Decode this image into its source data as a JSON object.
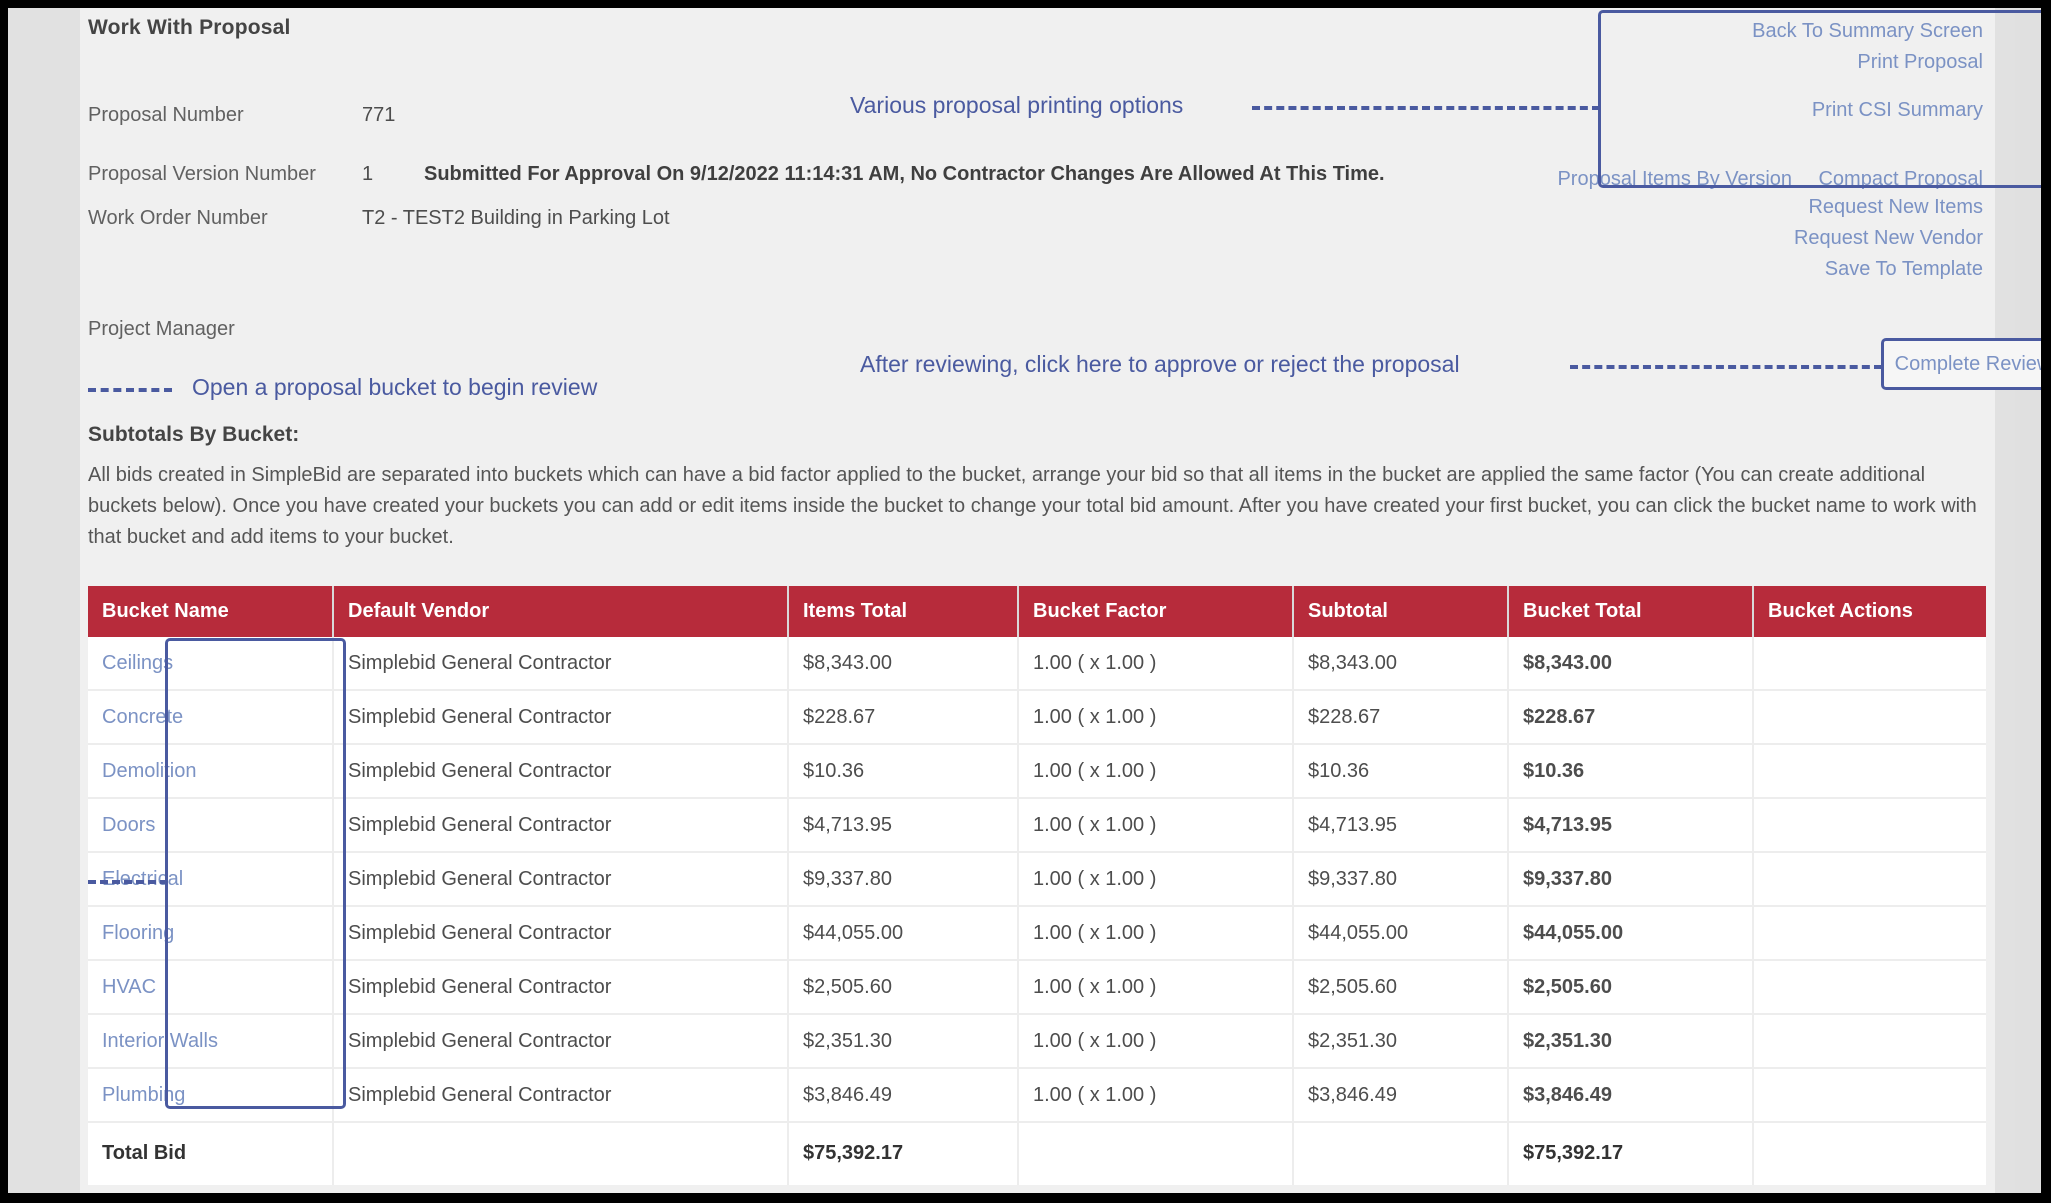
{
  "header": {
    "title": "Work With Proposal",
    "fields": [
      {
        "label": "Proposal Number",
        "value": "771"
      },
      {
        "label": "Proposal Version Number",
        "value": "1"
      },
      {
        "label": "Work Order Number",
        "value": "T2 - TEST2 Building in Parking Lot"
      },
      {
        "label": "Project Manager",
        "value": ""
      }
    ],
    "submitted_note": "Submitted For Approval On 9/12/2022 11:14:31 AM, No Contractor Changes Are Allowed At This Time."
  },
  "nav_links": {
    "back_to_summary": "Back To Summary Screen",
    "print_proposal": "Print Proposal",
    "print_csi_summary": "Print CSI Summary",
    "proposal_items_by_version": "Proposal Items By Version",
    "compact_proposal": "Compact Proposal",
    "request_new_items": "Request New Items",
    "request_new_vendor": "Request New Vendor",
    "save_to_template": "Save To Template",
    "complete_review": "Complete Review"
  },
  "annotations": {
    "printing_options": "Various proposal printing options",
    "complete_review": "After reviewing, click here to approve or reject the proposal",
    "open_bucket": "Open a proposal bucket to begin review"
  },
  "subtotals": {
    "heading": "Subtotals By Bucket:",
    "intro": "All bids created in SimpleBid are separated into buckets which can have a bid factor applied to the bucket, arrange your bid so that all items in the bucket are applied the same factor (You can create additional buckets below).  Once you have created your buckets you can add or edit items inside the bucket to change your total bid amount.  After you have created your first bucket, you can click the bucket name to work with that bucket and add items to your bucket."
  },
  "table": {
    "columns": [
      "Bucket Name",
      "Default Vendor",
      "Items  Total",
      "Bucket Factor",
      "Subtotal",
      "Bucket Total",
      "Bucket Actions"
    ],
    "rows": [
      {
        "name": "Ceilings",
        "vendor": "Simplebid General Contractor",
        "items_total": "$8,343.00",
        "factor": "1.00 ( x 1.00 )",
        "subtotal": "$8,343.00",
        "bucket_total": "$8,343.00",
        "actions": ""
      },
      {
        "name": "Concrete",
        "vendor": "Simplebid General Contractor",
        "items_total": "$228.67",
        "factor": "1.00 ( x 1.00 )",
        "subtotal": "$228.67",
        "bucket_total": "$228.67",
        "actions": ""
      },
      {
        "name": "Demolition",
        "vendor": "Simplebid General Contractor",
        "items_total": "$10.36",
        "factor": "1.00 ( x 1.00 )",
        "subtotal": "$10.36",
        "bucket_total": "$10.36",
        "actions": ""
      },
      {
        "name": "Doors",
        "vendor": "Simplebid General Contractor",
        "items_total": "$4,713.95",
        "factor": "1.00 ( x 1.00 )",
        "subtotal": "$4,713.95",
        "bucket_total": "$4,713.95",
        "actions": ""
      },
      {
        "name": "Electrical",
        "vendor": "Simplebid General Contractor",
        "items_total": "$9,337.80",
        "factor": "1.00 ( x 1.00 )",
        "subtotal": "$9,337.80",
        "bucket_total": "$9,337.80",
        "actions": ""
      },
      {
        "name": "Flooring",
        "vendor": "Simplebid General Contractor",
        "items_total": "$44,055.00",
        "factor": "1.00 ( x 1.00 )",
        "subtotal": "$44,055.00",
        "bucket_total": "$44,055.00",
        "actions": ""
      },
      {
        "name": "HVAC",
        "vendor": "Simplebid General Contractor",
        "items_total": "$2,505.60",
        "factor": "1.00 ( x 1.00 )",
        "subtotal": "$2,505.60",
        "bucket_total": "$2,505.60",
        "actions": ""
      },
      {
        "name": "Interior Walls",
        "vendor": "Simplebid General Contractor",
        "items_total": "$2,351.30",
        "factor": "1.00 ( x 1.00 )",
        "subtotal": "$2,351.30",
        "bucket_total": "$2,351.30",
        "actions": ""
      },
      {
        "name": "Plumbing",
        "vendor": "Simplebid General Contractor",
        "items_total": "$3,846.49",
        "factor": "1.00 ( x 1.00 )",
        "subtotal": "$3,846.49",
        "bucket_total": "$3,846.49",
        "actions": ""
      }
    ],
    "total_row": {
      "label": "Total Bid",
      "vendor": "",
      "items_total": "$75,392.17",
      "factor": "",
      "subtotal": "",
      "bucket_total": "$75,392.17",
      "actions": ""
    }
  },
  "colors": {
    "table_header_red": "#b72b3b",
    "link_blue": "#7b92c4",
    "annotation_blue": "#4a5aa0",
    "page_background": "#f0f0f0"
  }
}
